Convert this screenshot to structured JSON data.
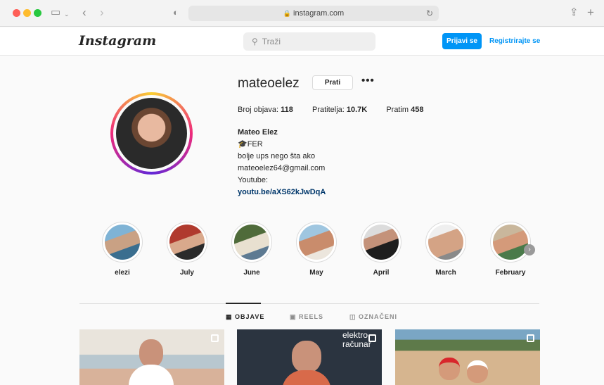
{
  "browser": {
    "url": "instagram.com"
  },
  "header": {
    "logo": "Instagram",
    "search_placeholder": "Traži",
    "login": "Prijavi se",
    "signup": "Registrirajte se"
  },
  "profile": {
    "username": "mateoelez",
    "follow": "Prati",
    "more": "•••",
    "posts_label": "Broj objava:",
    "posts_value": "118",
    "followers_label": "Pratitelja:",
    "followers_value": "10.7K",
    "following_label": "Pratim",
    "following_value": "458",
    "full_name": "Mateo Elez",
    "bio_line1": "FER",
    "bio_line2": "bolje ups nego šta ako",
    "bio_line3": "mateoelez64@gmail.com",
    "bio_line4": "Youtube:",
    "bio_link": "youtu.be/aXS62kJwDqA"
  },
  "highlights": [
    {
      "label": "elezi"
    },
    {
      "label": "July"
    },
    {
      "label": "June"
    },
    {
      "label": "May"
    },
    {
      "label": "April"
    },
    {
      "label": "March"
    },
    {
      "label": "February"
    }
  ],
  "tabs": [
    {
      "label": "OBJAVE"
    },
    {
      "label": "REELS"
    },
    {
      "label": "OZNAČENI"
    }
  ],
  "posts": [
    {
      "caption": ""
    },
    {
      "caption": "elektro računar"
    },
    {
      "caption": ""
    }
  ]
}
